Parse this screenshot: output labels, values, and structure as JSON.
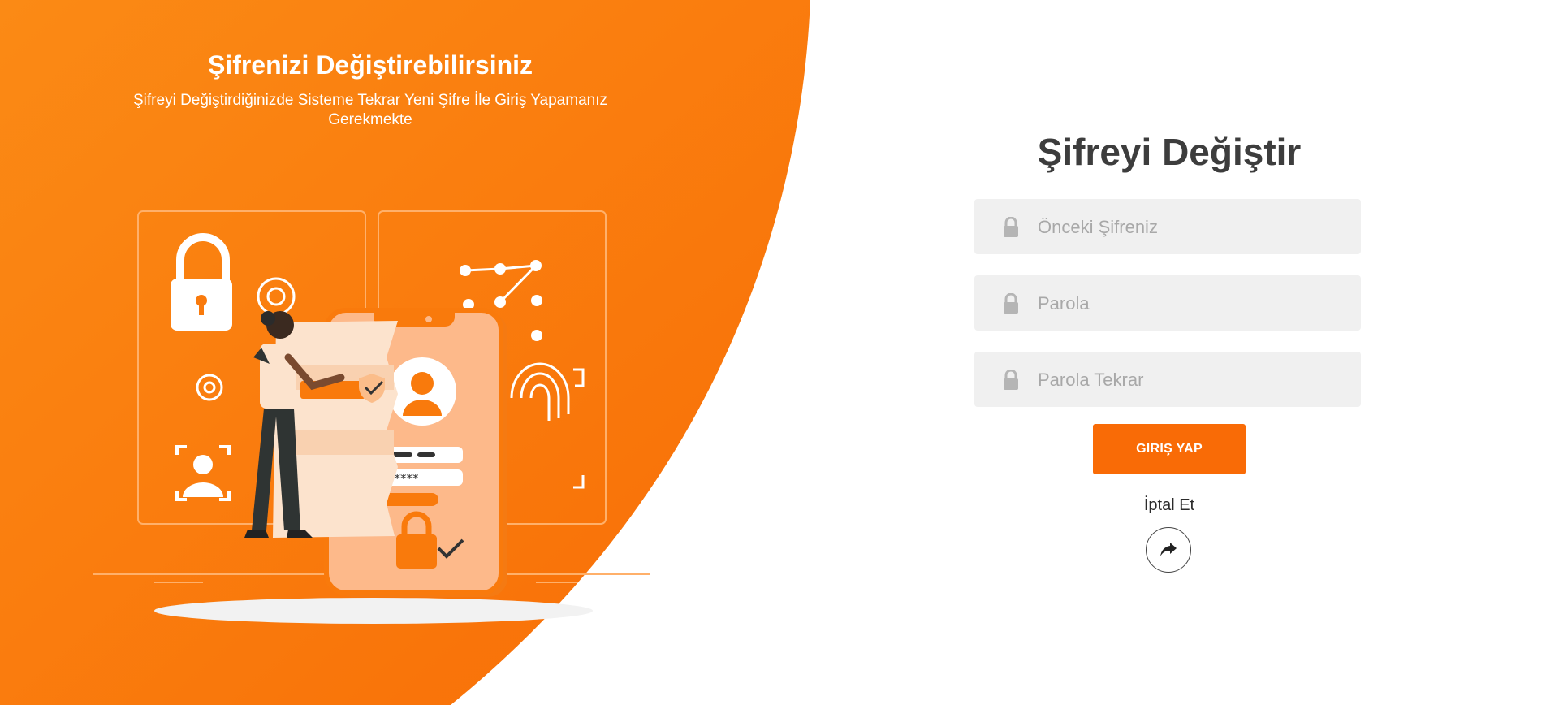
{
  "left": {
    "title": "Şifrenizi Değiştirebilirsiniz",
    "subtitle": "Şifreyi Değiştirdiğinizde Sisteme Tekrar Yeni Şifre İle Giriş Yapamanız Gerekmekte"
  },
  "form": {
    "title": "Şifreyi Değiştir",
    "fields": [
      {
        "placeholder": "Önceki Şifreniz",
        "value": "",
        "icon": "lock-icon"
      },
      {
        "placeholder": "Parola",
        "value": "",
        "icon": "lock-icon"
      },
      {
        "placeholder": "Parola Tekrar",
        "value": "",
        "icon": "lock-icon"
      }
    ],
    "submit_label": "GIRIŞ YAP",
    "cancel_label": "İptal Et",
    "share_icon": "share-arrow-icon"
  },
  "colors": {
    "accent": "#f96b06",
    "field_bg": "#f0f0f0",
    "title": "#3d3d3d"
  }
}
